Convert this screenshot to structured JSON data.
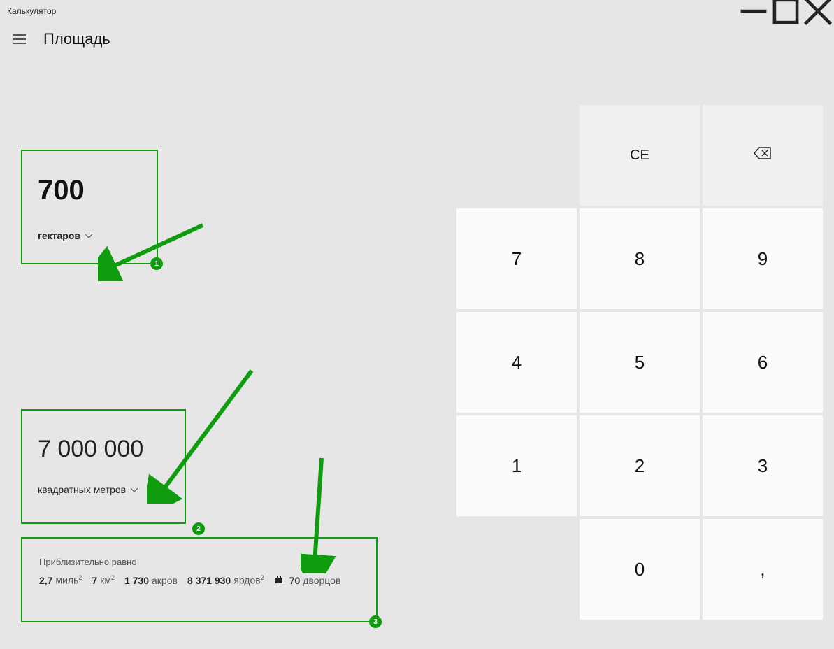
{
  "window": {
    "title": "Калькулятор"
  },
  "header": {
    "mode": "Площадь"
  },
  "input1": {
    "value": "700",
    "unit": "гектаров"
  },
  "input2": {
    "value": "7 000 000",
    "unit": "квадратных метров"
  },
  "approx": {
    "title": "Приблизительно равно",
    "items": [
      {
        "val": "2,7",
        "unit": "миль",
        "sup": "2"
      },
      {
        "val": "7",
        "unit": "км",
        "sup": "2"
      },
      {
        "val": "1 730",
        "unit": "акров",
        "sup": ""
      },
      {
        "val": "8 371 930",
        "unit": "ярдов",
        "sup": "2"
      },
      {
        "val": "70",
        "unit": "дворцов",
        "sup": "",
        "icon": "castle"
      }
    ]
  },
  "badges": {
    "b1": "1",
    "b2": "2",
    "b3": "3"
  },
  "keypad": {
    "ce": "CE",
    "k7": "7",
    "k8": "8",
    "k9": "9",
    "k4": "4",
    "k5": "5",
    "k6": "6",
    "k1": "1",
    "k2": "2",
    "k3": "3",
    "k0": "0",
    "comma": ","
  }
}
